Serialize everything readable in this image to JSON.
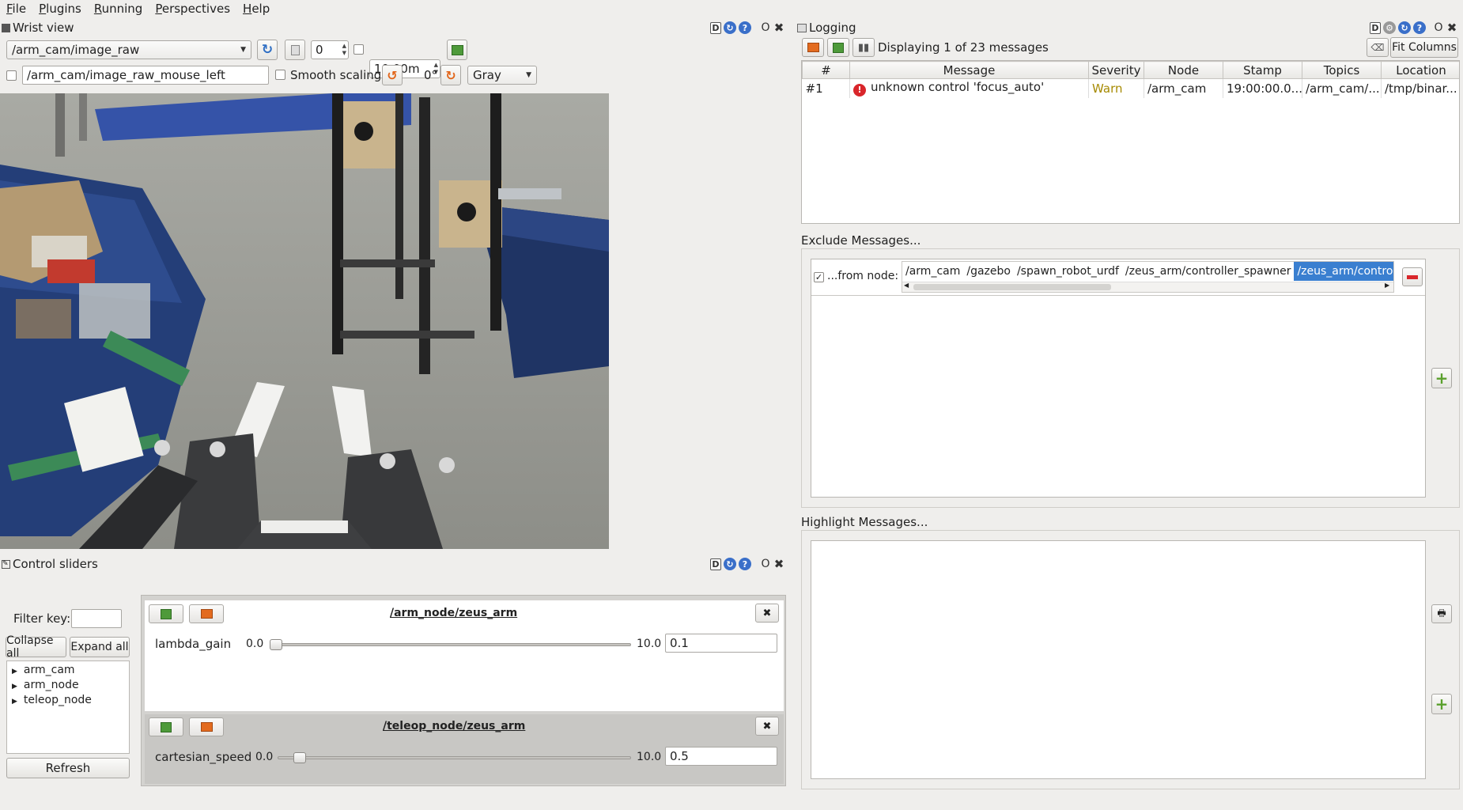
{
  "menubar": {
    "items": [
      "File",
      "Plugins",
      "Running",
      "Perspectives",
      "Help"
    ]
  },
  "wrist_view": {
    "title": "Wrist view",
    "topic": "/arm_cam/image_raw",
    "spin_value": "0",
    "max_range": "10.00m",
    "mouse_topic": "/arm_cam/image_raw_mouse_left",
    "smooth_scaling_label": "Smooth scaling",
    "rotation": "0°",
    "color_scheme": "Gray"
  },
  "dock_controls": {
    "d": "D",
    "o": "O",
    "x": "✖"
  },
  "control_sliders": {
    "title": "Control sliders",
    "filter_label": "Filter key:",
    "filter_value": "",
    "collapse_all": "Collapse all",
    "expand_all": "Expand all",
    "tree": [
      "arm_cam",
      "arm_node",
      "teleop_node"
    ],
    "refresh": "Refresh",
    "groups": [
      {
        "name": "/arm_node/zeus_arm",
        "param": "lambda_gain",
        "min": "0.0",
        "max": "10.0",
        "value": "0.1",
        "fraction": 0.01
      },
      {
        "name": "/teleop_node/zeus_arm",
        "param": "cartesian_speed",
        "min": "0.0",
        "max": "10.0",
        "value": "0.5",
        "fraction": 0.05
      }
    ]
  },
  "logging": {
    "title": "Logging",
    "status": "Displaying 1 of 23 messages",
    "fit_columns": "Fit Columns",
    "columns": [
      "#",
      "Message",
      "Severity",
      "Node",
      "Stamp",
      "Topics",
      "Location"
    ],
    "rows": [
      {
        "num": "#1",
        "message": "unknown control 'focus_auto'",
        "severity": "Warn",
        "node": "/arm_cam",
        "stamp": "19:00:00.0...",
        "topics": "/arm_cam/...",
        "location": "/tmp/binar..."
      }
    ],
    "exclude_label": "Exclude Messages...",
    "from_node_label": "...from node:",
    "from_nodes": [
      "/arm_cam",
      "/gazebo",
      "/spawn_robot_urdf",
      "/zeus_arm/controller_spawner",
      "/zeus_arm/controll"
    ],
    "highlight_label": "Highlight Messages..."
  },
  "colors": {
    "accent": "#3a7fd0",
    "warn": "#a68a00",
    "error": "#d9262b",
    "add": "#5aa02c"
  }
}
